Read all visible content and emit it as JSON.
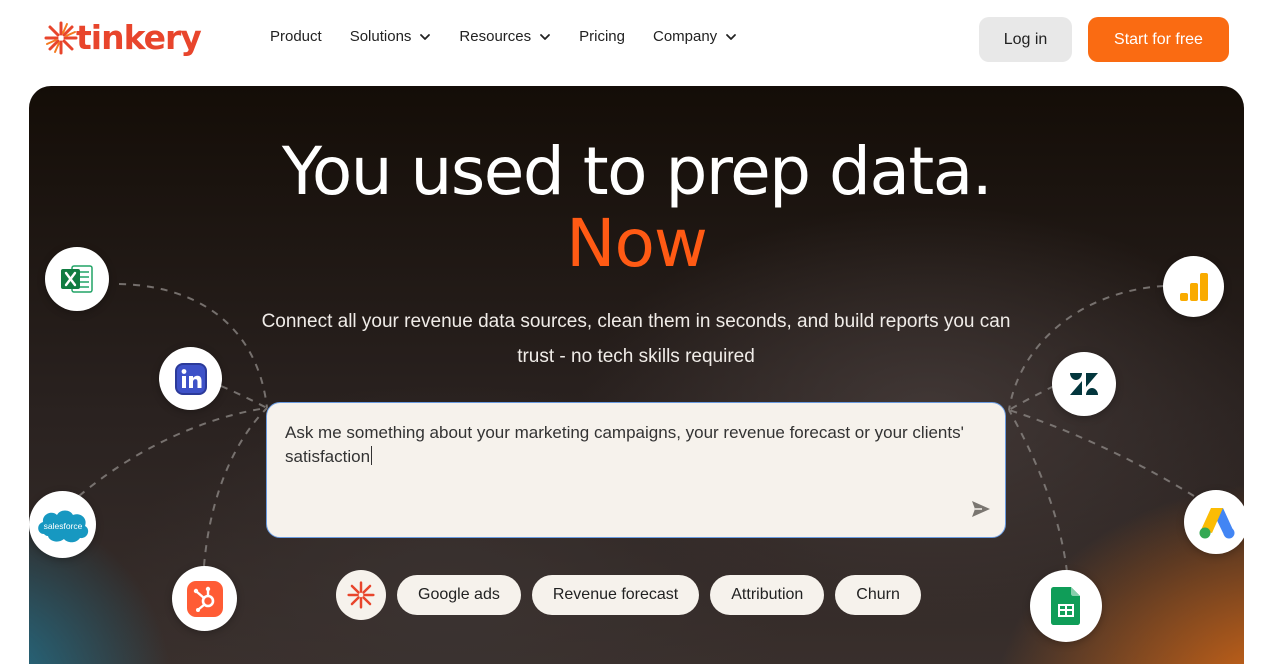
{
  "brand": {
    "name": "tinkery",
    "color": "#e8452c"
  },
  "nav": {
    "items": [
      {
        "label": "Product",
        "has_dropdown": false
      },
      {
        "label": "Solutions",
        "has_dropdown": true
      },
      {
        "label": "Resources",
        "has_dropdown": true
      },
      {
        "label": "Pricing",
        "has_dropdown": false
      },
      {
        "label": "Company",
        "has_dropdown": true
      }
    ],
    "login_label": "Log in",
    "start_label": "Start for free"
  },
  "hero": {
    "headline": "You used to prep data.",
    "headline_accent": "Now",
    "subtitle": "Connect all your revenue data sources, clean them in seconds, and build reports you can trust - no tech skills required",
    "prompt": {
      "value": "Ask me something about your marketing campaigns, your revenue forecast or your clients' satisfaction",
      "send_icon": "send-icon"
    },
    "suggestions": [
      "Google ads",
      "Revenue forecast",
      "Attribution",
      "Churn"
    ],
    "integrations": [
      {
        "name": "Excel",
        "icon": "excel-icon"
      },
      {
        "name": "LinkedIn",
        "icon": "linkedin-icon"
      },
      {
        "name": "Salesforce",
        "icon": "salesforce-icon",
        "label": "salesforce"
      },
      {
        "name": "HubSpot",
        "icon": "hubspot-icon"
      },
      {
        "name": "Google Analytics",
        "icon": "google-analytics-icon"
      },
      {
        "name": "Zendesk",
        "icon": "zendesk-icon"
      },
      {
        "name": "Google Ads",
        "icon": "google-ads-icon"
      },
      {
        "name": "Google Sheets",
        "icon": "google-sheets-icon"
      }
    ]
  },
  "colors": {
    "accent": "#fa6b12",
    "accent_text": "#ff5a14",
    "login_bg": "#e8e8e8",
    "prompt_border": "#6a9be0"
  }
}
